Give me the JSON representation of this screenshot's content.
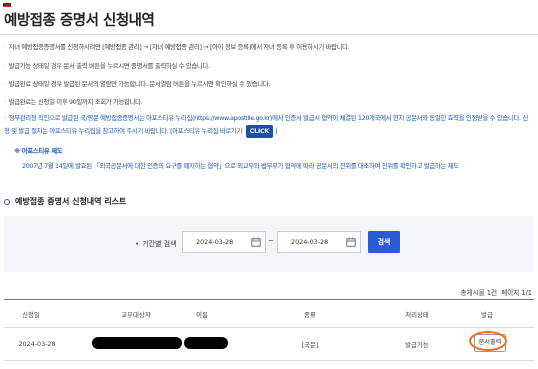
{
  "page": {
    "title": "예방접종 증명서 신청내역"
  },
  "notices": [
    "자녀 예방접종증명서를 신청하시려면 [예방접종 관리] → [자녀 예방접종 관리] → [아이 정보 등록]에서 자녀 등록 후 이용하시기 바랍니다.",
    "발급가능 상태일 경우 문서 출력 버튼을 누르시면 증명서를 출력하실 수 있습니다.",
    "발급완료 상태일 경우 발급된 문서의 열람만 가능합니다. 문서열람 버튼을 누르시면 확인하실 수 있습니다.",
    "발급완료는 신청일 이후 90일까지 조회가 가능합니다."
  ],
  "apostille": {
    "intro": "정부관리청 직인으로 발급된 국/영문 예방접종증명서는 아포스티유 누리집(https://www.apostille.go.kr)에서 인증서 발급시 협약이 체결된 120개국에서 현지 공문서와 동일한 효력을 인정받을 수 있습니다. 신청 및 발급 절차는 아포스티유 누리집을 참고하여 주시기 바랍니다.",
    "link_text": "[아포스티유 누리집 바로가기",
    "click_label": "CLICK",
    "link_suffix": "]",
    "section_title": "※ 아포스티유 제도",
    "description": "2007년 7월 14일에 발효된 「외국공문서에 대한 인증의 요구를 폐지하는 협약」으로 외교부와 법무부가 협약에 따라 공문서의 진위를 대조하여 진위를 확인하고 발급하는 제도"
  },
  "list": {
    "title": "예방접종 증명서 신청내역 리스트",
    "search": {
      "label": "기간별 검색",
      "start_date": "2024-03-28",
      "end_date": "2024-03-28",
      "separator": "~",
      "button_label": "검색"
    },
    "total_text": "총게시물 1건",
    "page_text": "페이지 1/1",
    "columns": [
      "신청일",
      "교부대상자",
      "이름",
      "종류",
      "처리상태",
      "발급"
    ],
    "rows": [
      {
        "date": "2024-03-28",
        "type": "[국문]",
        "status": "발급가능",
        "action": "문서출력"
      }
    ]
  },
  "colors": {
    "accent": "#2a5bd7",
    "link": "#1f56b5",
    "highlight": "#f36f21"
  }
}
